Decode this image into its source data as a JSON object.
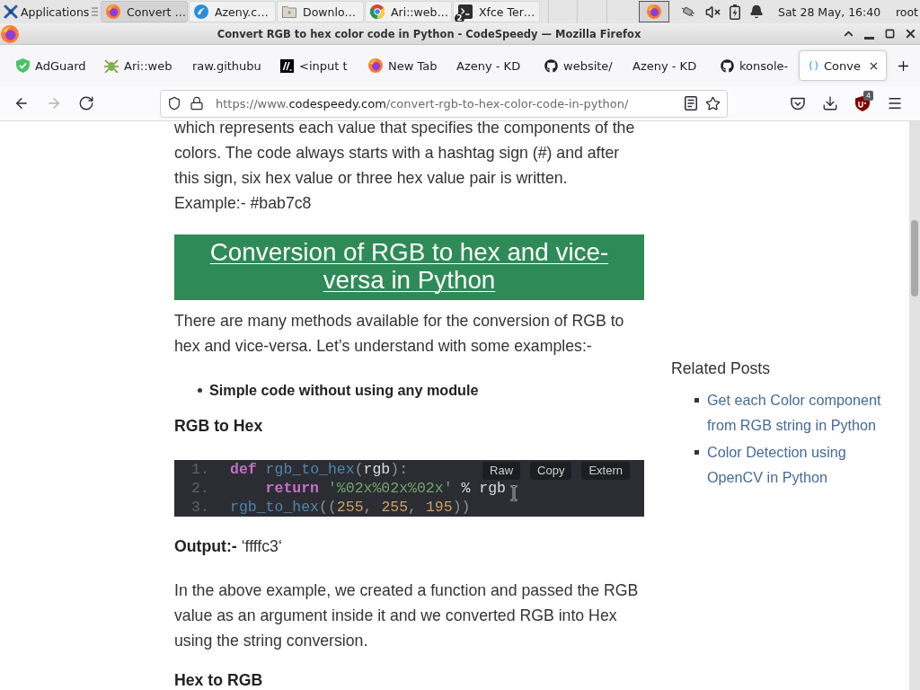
{
  "taskbar": {
    "menu_label": "Applications",
    "tasks": [
      {
        "label": "Convert …",
        "selected": true
      },
      {
        "label": "Azeny.c…",
        "selected": false
      },
      {
        "label": "Downlo…",
        "selected": false
      },
      {
        "label": "Ari::web…",
        "selected": false
      },
      {
        "label": "Xfce Ter…",
        "selected": false,
        "badge": "2"
      }
    ],
    "clock": "Sat 28 May, 16:40",
    "user": "root"
  },
  "window": {
    "title": "Convert RGB to hex color code in Python - CodeSpeedy — Mozilla Firefox"
  },
  "tabs": [
    {
      "label": "AdGuard",
      "selected": false
    },
    {
      "label": "Ari::web",
      "selected": false
    },
    {
      "label": "raw.githubu",
      "selected": false
    },
    {
      "label": "<input t",
      "selected": false
    },
    {
      "label": "New Tab",
      "selected": false
    },
    {
      "label": "Azeny - KD",
      "selected": false
    },
    {
      "label": "website/",
      "selected": false
    },
    {
      "label": "Azeny - KD",
      "selected": false
    },
    {
      "label": "konsole-",
      "selected": false
    },
    {
      "label": "Conve",
      "selected": true
    }
  ],
  "toolbar": {
    "nav_buttons": [
      {
        "kind": "back",
        "disabled": false
      },
      {
        "kind": "forward",
        "disabled": true
      },
      {
        "kind": "reload",
        "disabled": false
      }
    ],
    "url": {
      "scheme": "https://www.",
      "domain": "codespeedy.com",
      "path": "/convert-rgb-to-hex-color-code-in-python/"
    },
    "extension_badge": "4"
  },
  "article": {
    "blocks": [
      {
        "kind": "paragraph",
        "text": "which represents each value that specifies the components of the colors. The code always starts with a hashtag sign (#) and after this sign, six hex value or three hex value pair is written.\nExample:- #bab7c8"
      },
      {
        "kind": "banner",
        "text": "Conversion of RGB to hex and vice-versa in Python"
      },
      {
        "kind": "paragraph",
        "text": "There are many methods available for the conversion of RGB to hex and vice-versa. Let’s understand with some examples:-"
      },
      {
        "kind": "bullets",
        "items": [
          "Simple code without using any module"
        ]
      },
      {
        "kind": "subheading",
        "text": "RGB to Hex"
      },
      {
        "kind": "code",
        "lines": [
          {
            "number": "1.",
            "tokens": [
              {
                "text": "def",
                "kind": "keyword"
              },
              {
                "text": " rgb_to_hex",
                "kind": "function"
              },
              {
                "text": "(",
                "kind": "punct"
              },
              {
                "text": "rgb",
                "kind": "plain"
              },
              {
                "text": "):",
                "kind": "punct"
              }
            ]
          },
          {
            "number": "2.",
            "tokens": [
              {
                "text": "    return",
                "kind": "keyword"
              },
              {
                "text": " '%02x%02x%02x'",
                "kind": "string"
              },
              {
                "text": " % rgb",
                "kind": "plain"
              }
            ]
          },
          {
            "number": "3.",
            "tokens": [
              {
                "text": "rgb_to_hex",
                "kind": "function"
              },
              {
                "text": "((",
                "kind": "punct"
              },
              {
                "text": "255",
                "kind": "number"
              },
              {
                "text": ", ",
                "kind": "punct"
              },
              {
                "text": "255",
                "kind": "number"
              },
              {
                "text": ", ",
                "kind": "punct"
              },
              {
                "text": "195",
                "kind": "number"
              },
              {
                "text": "))",
                "kind": "punct"
              }
            ]
          }
        ],
        "buttons": [
          "Raw",
          "Copy",
          "Extern"
        ]
      },
      {
        "kind": "paragraph",
        "text": "**Output:-** ‘ffffc3‘"
      },
      {
        "kind": "paragraph",
        "text": "In the above example, we created a function and passed the RGB value as an argument inside it and we converted RGB into Hex using the string conversion."
      },
      {
        "kind": "subheading",
        "text": "Hex to RGB"
      }
    ]
  },
  "sidebar": {
    "title": "Related Posts",
    "links": [
      "Get each Color component from RGB string in Python",
      "Color Detection using OpenCV in Python"
    ]
  }
}
